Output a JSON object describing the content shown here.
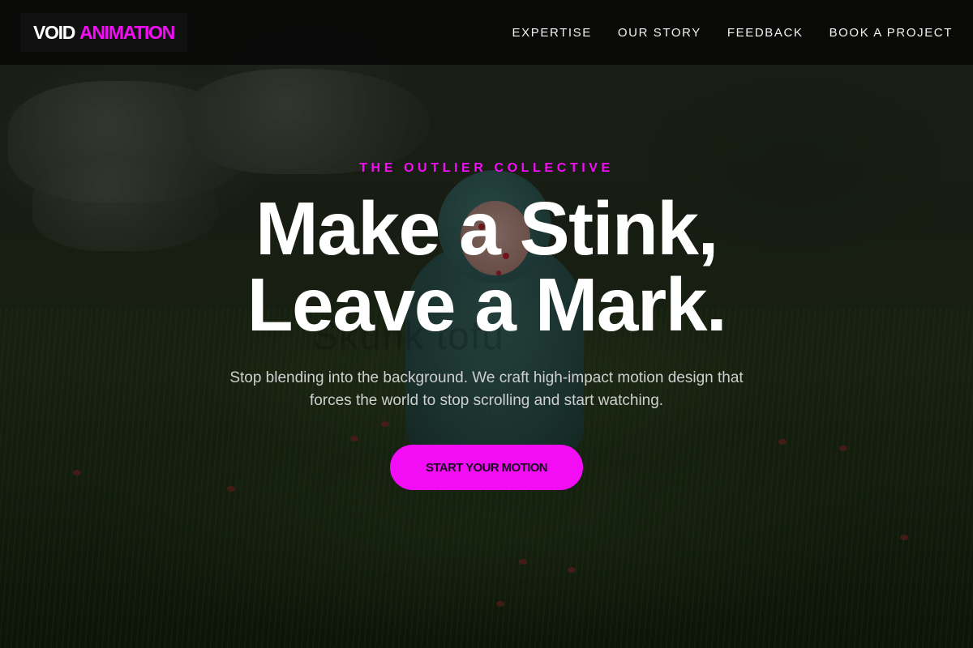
{
  "brand": {
    "logo_word1": "VOID",
    "logo_word2": "ANIMATION",
    "accent_color": "#f20df5"
  },
  "nav": {
    "links": [
      {
        "label": "EXPERTISE"
      },
      {
        "label": "OUR STORY"
      },
      {
        "label": "FEEDBACK"
      },
      {
        "label": "BOOK A PROJECT"
      }
    ]
  },
  "hero": {
    "eyebrow": "THE OUTLIER COLLECTIVE",
    "headline_line1": "Make a Stink,",
    "headline_line2": "Leave a Mark.",
    "subtitle": "Stop blending into the background. We craft high-impact motion design that forces the world to stop scrolling and start watching.",
    "cta_label": "START YOUR MOTION",
    "background_watermark": "Skunk tofu"
  }
}
